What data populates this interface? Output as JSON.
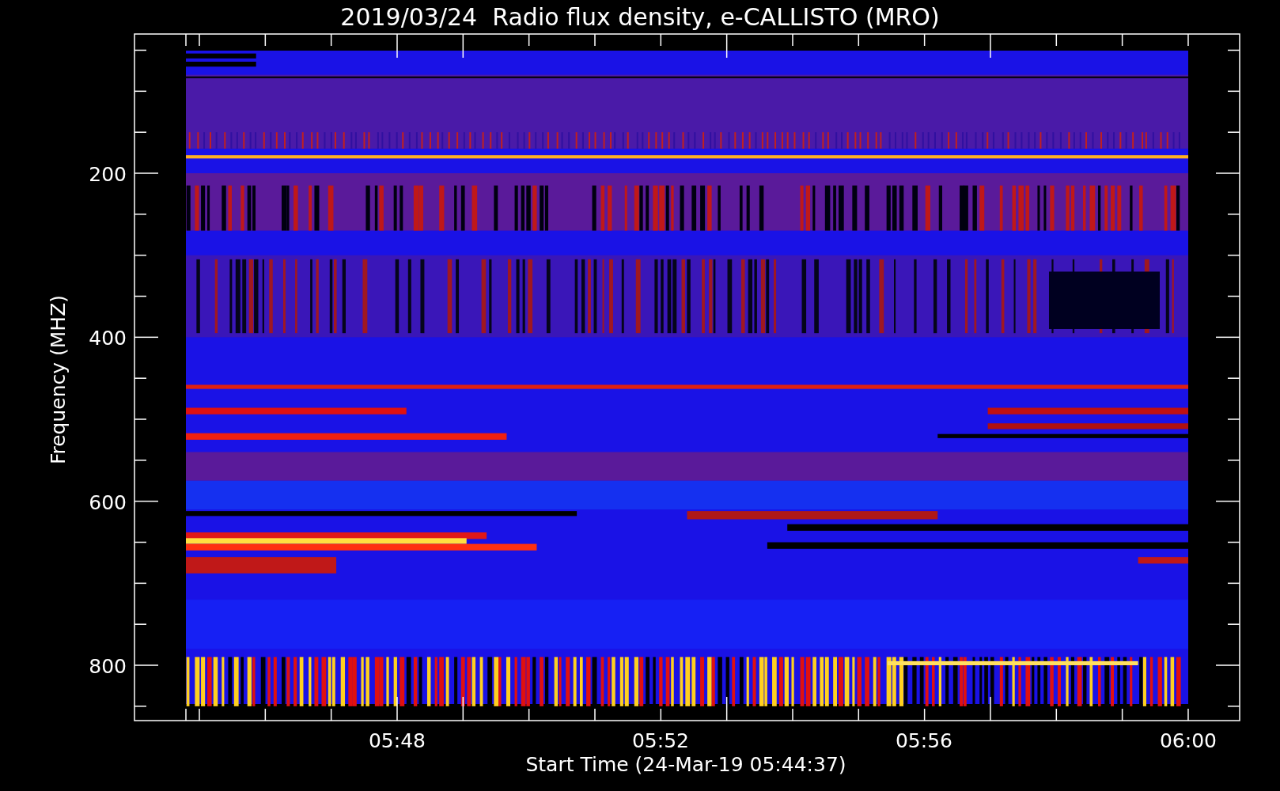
{
  "chart": {
    "title": "2019/03/24  Radio flux density, e-CALLISTO (MRO)",
    "ylabel": "Frequency (MHZ)",
    "xlabel": "Start Time (24-Mar-19 05:44:37)",
    "yticks": [
      {
        "label": "200"
      },
      {
        "label": "400"
      },
      {
        "label": "600"
      },
      {
        "label": "800"
      }
    ],
    "xticks": [
      {
        "label": "05:48"
      },
      {
        "label": "05:52"
      },
      {
        "label": "05:56"
      },
      {
        "label": "06:00"
      }
    ]
  }
}
